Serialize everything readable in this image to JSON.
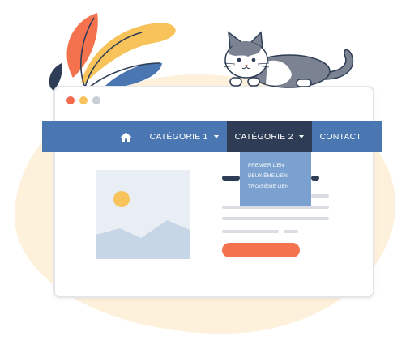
{
  "nav": {
    "items": [
      {
        "label": "CATÉGORIE 1"
      },
      {
        "label": "CATÉGORIE 2"
      },
      {
        "label": "CONTACT"
      }
    ]
  },
  "dropdown": {
    "items": [
      {
        "label": "PREMIER LIEN"
      },
      {
        "label": "DEUXIÈME LIEN"
      },
      {
        "label": "TROISIÈME LIEN"
      }
    ]
  },
  "icons": {
    "home": "home-icon",
    "caret": "caret-down-icon"
  },
  "colors": {
    "navbar": "#4a77b2",
    "navbar_active": "#2e3d55",
    "dropdown": "#7aa1cf",
    "button": "#f4734e",
    "dot_red": "#f2694b",
    "dot_yellow": "#f7c35a",
    "dot_gray": "#c9cdd6",
    "background_blob": "#fdf1dc"
  }
}
